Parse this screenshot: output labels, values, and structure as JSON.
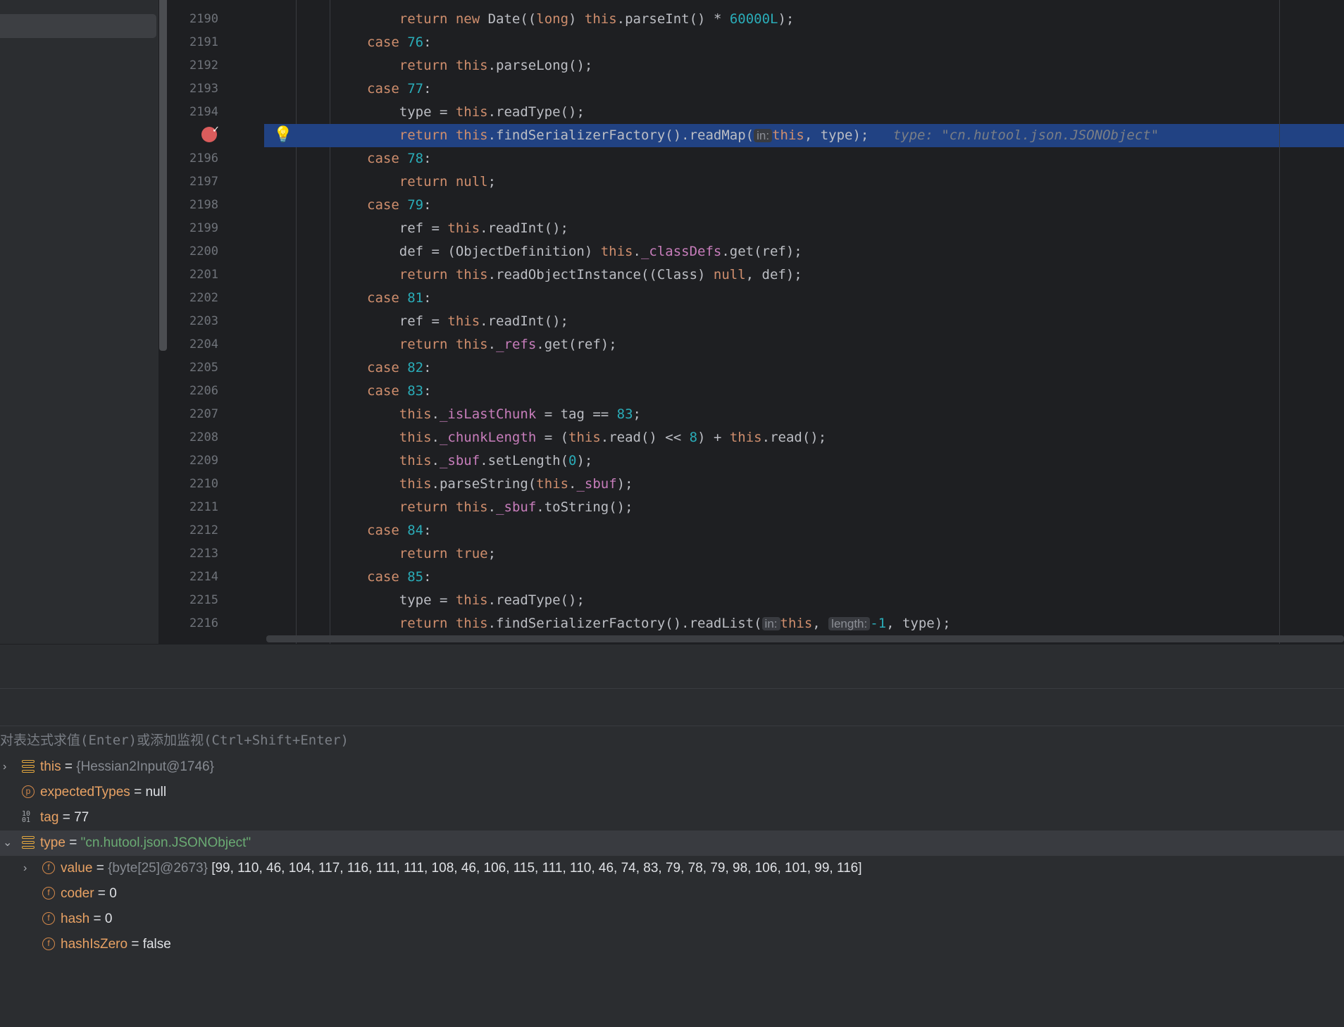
{
  "editor": {
    "lines": [
      {
        "num": "2190",
        "code": [
          [
            "",
            "    "
          ],
          [
            "kw",
            "return new "
          ],
          [
            "",
            "Date(("
          ],
          [
            "kw",
            "long"
          ],
          [
            "",
            ") "
          ],
          [
            "kw",
            "this"
          ],
          [
            "",
            ".parseInt() * "
          ],
          [
            "num",
            "60000L"
          ],
          [
            "",
            ");"
          ]
        ]
      },
      {
        "num": "2191",
        "code": [
          [
            "kw",
            "case "
          ],
          [
            "num",
            "76"
          ],
          [
            "",
            ":"
          ]
        ]
      },
      {
        "num": "2192",
        "code": [
          [
            "",
            "    "
          ],
          [
            "kw",
            "return this"
          ],
          [
            "",
            ".parseLong();"
          ]
        ]
      },
      {
        "num": "2193",
        "code": [
          [
            "kw",
            "case "
          ],
          [
            "num",
            "77"
          ],
          [
            "",
            ":"
          ]
        ]
      },
      {
        "num": "2194",
        "code": [
          [
            "",
            "    type = "
          ],
          [
            "kw",
            "this"
          ],
          [
            "",
            ".readType();"
          ]
        ]
      },
      {
        "num": "",
        "current": true,
        "code": [
          [
            "",
            "    "
          ],
          [
            "kw",
            "return this"
          ],
          [
            "",
            ".findSerializerFactory().readMap("
          ],
          [
            "hint",
            "in:"
          ],
          [
            "kw",
            "this"
          ],
          [
            "",
            ", type);   "
          ],
          [
            "inl",
            "type: \"cn.hutool.json.JSONObject\""
          ]
        ]
      },
      {
        "num": "2196",
        "code": [
          [
            "kw",
            "case "
          ],
          [
            "num",
            "78"
          ],
          [
            "",
            ":"
          ]
        ]
      },
      {
        "num": "2197",
        "code": [
          [
            "",
            "    "
          ],
          [
            "kw",
            "return null"
          ],
          [
            "",
            ";"
          ]
        ]
      },
      {
        "num": "2198",
        "code": [
          [
            "kw",
            "case "
          ],
          [
            "num",
            "79"
          ],
          [
            "",
            ":"
          ]
        ]
      },
      {
        "num": "2199",
        "code": [
          [
            "",
            "    ref = "
          ],
          [
            "kw",
            "this"
          ],
          [
            "",
            ".readInt();"
          ]
        ]
      },
      {
        "num": "2200",
        "code": [
          [
            "",
            "    def = (ObjectDefinition) "
          ],
          [
            "kw",
            "this"
          ],
          [
            "",
            "."
          ],
          [
            "fld",
            "_classDefs"
          ],
          [
            "",
            ".get(ref);"
          ]
        ]
      },
      {
        "num": "2201",
        "code": [
          [
            "",
            "    "
          ],
          [
            "kw",
            "return this"
          ],
          [
            "",
            ".readObjectInstance((Class) "
          ],
          [
            "kw",
            "null"
          ],
          [
            "",
            ", def);"
          ]
        ]
      },
      {
        "num": "2202",
        "code": [
          [
            "kw",
            "case "
          ],
          [
            "num",
            "81"
          ],
          [
            "",
            ":"
          ]
        ]
      },
      {
        "num": "2203",
        "code": [
          [
            "",
            "    ref = "
          ],
          [
            "kw",
            "this"
          ],
          [
            "",
            ".readInt();"
          ]
        ]
      },
      {
        "num": "2204",
        "code": [
          [
            "",
            "    "
          ],
          [
            "kw",
            "return this"
          ],
          [
            "",
            "."
          ],
          [
            "fld",
            "_refs"
          ],
          [
            "",
            ".get(ref);"
          ]
        ]
      },
      {
        "num": "2205",
        "code": [
          [
            "kw",
            "case "
          ],
          [
            "num",
            "82"
          ],
          [
            "",
            ":"
          ]
        ]
      },
      {
        "num": "2206",
        "code": [
          [
            "kw",
            "case "
          ],
          [
            "num",
            "83"
          ],
          [
            "",
            ":"
          ]
        ]
      },
      {
        "num": "2207",
        "code": [
          [
            "",
            "    "
          ],
          [
            "kw",
            "this"
          ],
          [
            "",
            "."
          ],
          [
            "fld",
            "_isLastChunk"
          ],
          [
            "",
            " = tag == "
          ],
          [
            "num",
            "83"
          ],
          [
            "",
            ";"
          ]
        ]
      },
      {
        "num": "2208",
        "code": [
          [
            "",
            "    "
          ],
          [
            "kw",
            "this"
          ],
          [
            "",
            "."
          ],
          [
            "fld",
            "_chunkLength"
          ],
          [
            "",
            " = ("
          ],
          [
            "kw",
            "this"
          ],
          [
            "",
            ".read() << "
          ],
          [
            "num",
            "8"
          ],
          [
            "",
            ") + "
          ],
          [
            "kw",
            "this"
          ],
          [
            "",
            ".read();"
          ]
        ]
      },
      {
        "num": "2209",
        "code": [
          [
            "",
            "    "
          ],
          [
            "kw",
            "this"
          ],
          [
            "",
            "."
          ],
          [
            "fld",
            "_sbuf"
          ],
          [
            "",
            ".setLength("
          ],
          [
            "num",
            "0"
          ],
          [
            "",
            ");"
          ]
        ]
      },
      {
        "num": "2210",
        "code": [
          [
            "",
            "    "
          ],
          [
            "kw",
            "this"
          ],
          [
            "",
            ".parseString("
          ],
          [
            "kw",
            "this"
          ],
          [
            "",
            "."
          ],
          [
            "fld",
            "_sbuf"
          ],
          [
            "",
            ");"
          ]
        ]
      },
      {
        "num": "2211",
        "code": [
          [
            "",
            "    "
          ],
          [
            "kw",
            "return this"
          ],
          [
            "",
            "."
          ],
          [
            "fld",
            "_sbuf"
          ],
          [
            "",
            ".toString();"
          ]
        ]
      },
      {
        "num": "2212",
        "code": [
          [
            "kw",
            "case "
          ],
          [
            "num",
            "84"
          ],
          [
            "",
            ":"
          ]
        ]
      },
      {
        "num": "2213",
        "code": [
          [
            "",
            "    "
          ],
          [
            "kw",
            "return true"
          ],
          [
            "",
            ";"
          ]
        ]
      },
      {
        "num": "2214",
        "code": [
          [
            "kw",
            "case "
          ],
          [
            "num",
            "85"
          ],
          [
            "",
            ":"
          ]
        ]
      },
      {
        "num": "2215",
        "code": [
          [
            "",
            "    type = "
          ],
          [
            "kw",
            "this"
          ],
          [
            "",
            ".readType();"
          ]
        ]
      },
      {
        "num": "2216",
        "code": [
          [
            "",
            "    "
          ],
          [
            "kw",
            "return this"
          ],
          [
            "",
            ".findSerializerFactory().readList("
          ],
          [
            "hint",
            "in:"
          ],
          [
            "kw",
            "this"
          ],
          [
            "",
            ", "
          ],
          [
            "hint",
            "length:"
          ],
          [
            "num",
            "-1"
          ],
          [
            "",
            ", type);"
          ]
        ]
      }
    ]
  },
  "evaluate": {
    "placeholder": "对表达式求值(Enter)或添加监视(Ctrl+Shift+Enter)"
  },
  "variables": [
    {
      "arrow": "›",
      "icon": "object-icon",
      "name": "this",
      "eq": " = ",
      "type": "{Hessian2Input@1746}",
      "value": ""
    },
    {
      "arrow": "",
      "icon": "parameter-icon",
      "name": "expectedTypes",
      "eq": " = ",
      "type": "",
      "value": "null"
    },
    {
      "arrow": "",
      "icon": "primitive-icon",
      "name": "tag",
      "eq": " = ",
      "type": "",
      "value": "77"
    },
    {
      "arrow": "⌄",
      "icon": "object-icon",
      "name": "type",
      "eq": " = ",
      "type": "",
      "str": "\"cn.hutool.json.JSONObject\"",
      "value": "",
      "selected": true
    },
    {
      "arrow": "›",
      "icon": "field-icon",
      "indent": 1,
      "name": "value",
      "eq": " = ",
      "type": "{byte[25]@2673}",
      "value": " [99, 110, 46, 104, 117, 116, 111, 111, 108, 46, 106, 115, 111, 110, 46, 74, 83, 79, 78, 79, 98, 106, 101, 99, 116]"
    },
    {
      "arrow": "",
      "icon": "field-icon",
      "indent": 1,
      "name": "coder",
      "eq": " = ",
      "type": "",
      "value": "0"
    },
    {
      "arrow": "",
      "icon": "field-icon",
      "indent": 1,
      "name": "hash",
      "eq": " = ",
      "type": "",
      "value": "0"
    },
    {
      "arrow": "",
      "icon": "field-icon",
      "indent": 1,
      "name": "hashIsZero",
      "eq": " = ",
      "type": "",
      "value": "false"
    }
  ],
  "icons": {
    "breakpoint": "breakpoint-icon",
    "bulb": "lightbulb-icon",
    "field_letter": "f",
    "param_letter": "p",
    "prim_glyph": "10\n01"
  },
  "colors": {
    "keyword": "#cf8e6d",
    "number": "#2aacb8",
    "field": "#c77dbb",
    "current_line": "#214283",
    "breakpoint": "#db5c5c"
  }
}
